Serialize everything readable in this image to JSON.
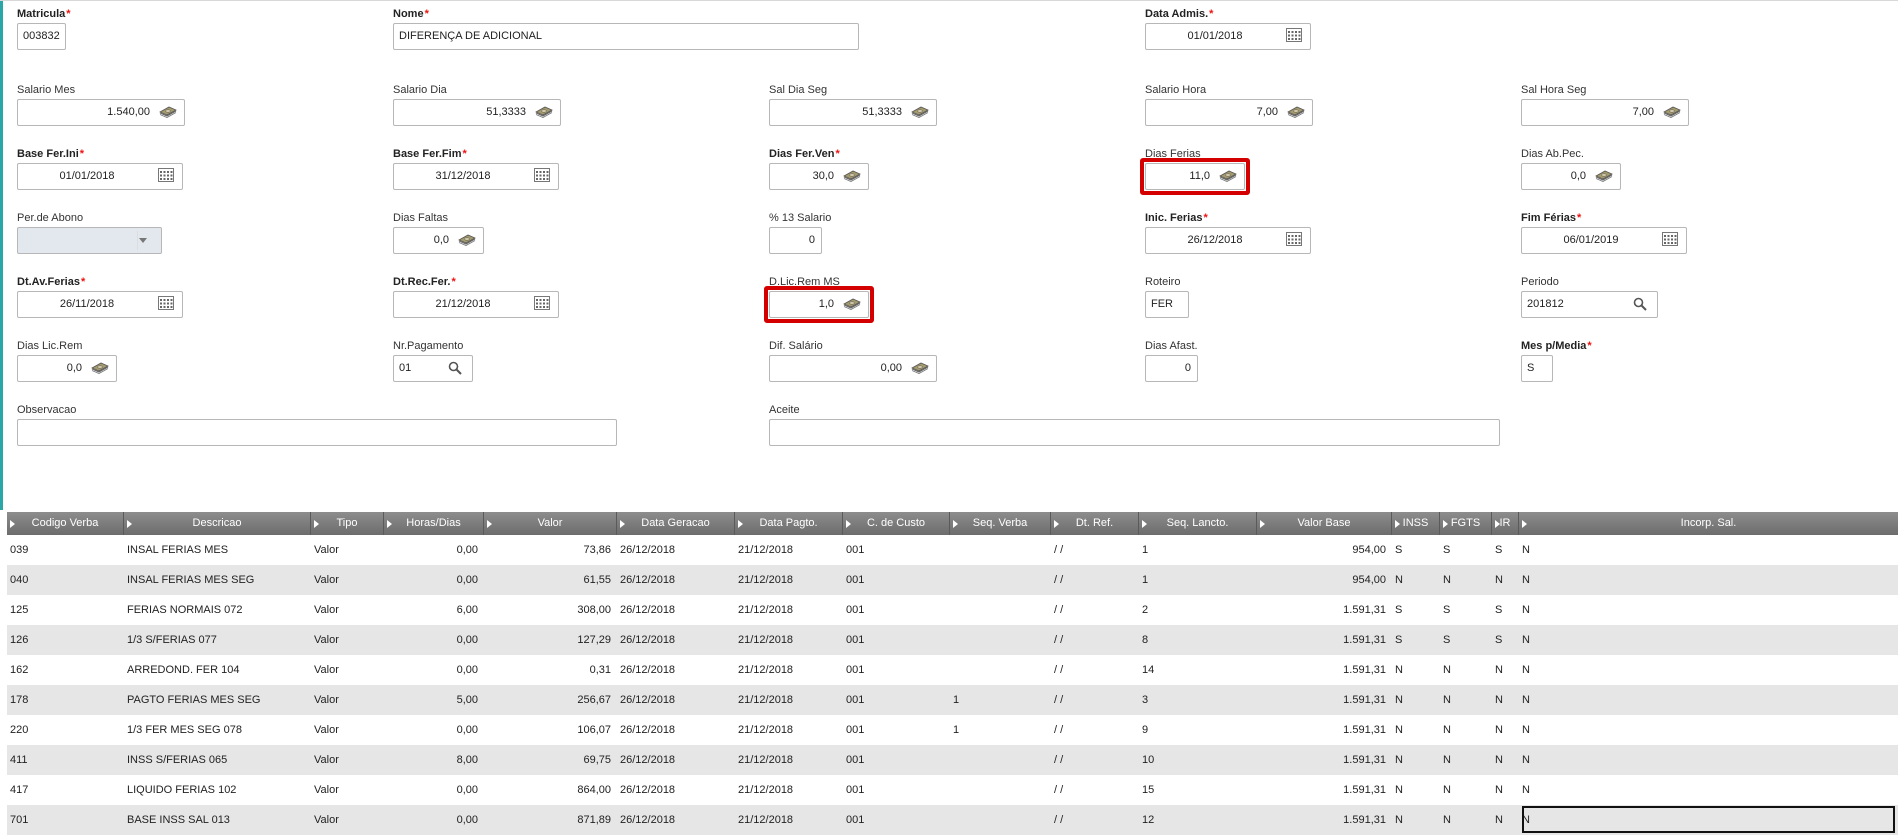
{
  "form": {
    "matricula": {
      "label": "Matricula",
      "value": "003832"
    },
    "nome": {
      "label": "Nome",
      "value": "DIFERENÇA DE ADICIONAL"
    },
    "data_admis": {
      "label": "Data Admis.",
      "value": "01/01/2018"
    },
    "salario_mes": {
      "label": "Salario Mes",
      "value": "1.540,00"
    },
    "salario_dia": {
      "label": "Salario Dia",
      "value": "51,3333"
    },
    "sal_dia_seg": {
      "label": "Sal Dia Seg",
      "value": "51,3333"
    },
    "salario_hora": {
      "label": "Salario Hora",
      "value": "7,00"
    },
    "sal_hora_seg": {
      "label": "Sal Hora Seg",
      "value": "7,00"
    },
    "base_fer_ini": {
      "label": "Base Fer.Ini",
      "value": "01/01/2018"
    },
    "base_fer_fim": {
      "label": "Base Fer.Fim",
      "value": "31/12/2018"
    },
    "dias_fer_ven": {
      "label": "Dias Fer.Ven",
      "value": "30,0"
    },
    "dias_ferias": {
      "label": "Dias Ferias",
      "value": "11,0"
    },
    "dias_ab_pec": {
      "label": "Dias Ab.Pec.",
      "value": "0,0"
    },
    "per_abono": {
      "label": "Per.de Abono",
      "value": ""
    },
    "dias_faltas": {
      "label": "Dias Faltas",
      "value": "0,0"
    },
    "pct_13_salario": {
      "label": "% 13 Salario",
      "value": "0"
    },
    "inic_ferias": {
      "label": "Inic. Ferias",
      "value": "26/12/2018"
    },
    "fim_ferias": {
      "label": "Fim Férias",
      "value": "06/01/2019"
    },
    "dt_av_ferias": {
      "label": "Dt.Av.Ferias",
      "value": "26/11/2018"
    },
    "dt_rec_fer": {
      "label": "Dt.Rec.Fer.",
      "value": "21/12/2018"
    },
    "d_lic_rem_ms": {
      "label": "D.Lic.Rem MS",
      "value": "1,0"
    },
    "roteiro": {
      "label": "Roteiro",
      "value": "FER"
    },
    "periodo": {
      "label": "Periodo",
      "value": "201812"
    },
    "dias_lic_rem": {
      "label": "Dias Lic.Rem",
      "value": "0,0"
    },
    "nr_pagamento": {
      "label": "Nr.Pagamento",
      "value": "01"
    },
    "dif_salario": {
      "label": "Dif. Salário",
      "value": "0,00"
    },
    "dias_afast": {
      "label": "Dias Afast.",
      "value": "0"
    },
    "mes_p_media": {
      "label": "Mes p/Media",
      "value": "S"
    },
    "observacao": {
      "label": "Observacao",
      "value": ""
    },
    "aceite": {
      "label": "Aceite",
      "value": ""
    }
  },
  "grid": {
    "columns": [
      "Codigo Verba",
      "Descricao",
      "Tipo",
      "Horas/Dias",
      "Valor",
      "Data Geracao",
      "Data Pagto.",
      "C. de Custo",
      "Seq. Verba",
      "Dt. Ref.",
      "Seq. Lancto.",
      "Valor Base",
      "INSS",
      "FGTS",
      "IR",
      "Incorp. Sal."
    ],
    "rows": [
      [
        "039",
        "INSAL FERIAS MES",
        "Valor",
        "0,00",
        "73,86",
        "26/12/2018",
        "21/12/2018",
        "001",
        "",
        " / /",
        "1",
        "954,00",
        "S",
        "S",
        "S",
        "N"
      ],
      [
        "040",
        "INSAL FERIAS MES SEG",
        "Valor",
        "0,00",
        "61,55",
        "26/12/2018",
        "21/12/2018",
        "001",
        "",
        " / /",
        "1",
        "954,00",
        "N",
        "N",
        "N",
        "N"
      ],
      [
        "125",
        "FERIAS NORMAIS 072",
        "Valor",
        "6,00",
        "308,00",
        "26/12/2018",
        "21/12/2018",
        "001",
        "",
        " / /",
        "2",
        "1.591,31",
        "S",
        "S",
        "S",
        "N"
      ],
      [
        "126",
        "1/3 S/FERIAS 077",
        "Valor",
        "0,00",
        "127,29",
        "26/12/2018",
        "21/12/2018",
        "001",
        "",
        " / /",
        "8",
        "1.591,31",
        "S",
        "S",
        "S",
        "N"
      ],
      [
        "162",
        "ARREDOND. FER 104",
        "Valor",
        "0,00",
        "0,31",
        "26/12/2018",
        "21/12/2018",
        "001",
        "",
        " / /",
        "14",
        "1.591,31",
        "N",
        "N",
        "N",
        "N"
      ],
      [
        "178",
        "PAGTO FERIAS MES SEG",
        "Valor",
        "5,00",
        "256,67",
        "26/12/2018",
        "21/12/2018",
        "001",
        "1",
        " / /",
        "3",
        "1.591,31",
        "N",
        "N",
        "N",
        "N"
      ],
      [
        "220",
        "1/3 FER MES SEG 078",
        "Valor",
        "0,00",
        "106,07",
        "26/12/2018",
        "21/12/2018",
        "001",
        "1",
        " / /",
        "9",
        "1.591,31",
        "N",
        "N",
        "N",
        "N"
      ],
      [
        "411",
        "INSS  S/FERIAS 065",
        "Valor",
        "8,00",
        "69,75",
        "26/12/2018",
        "21/12/2018",
        "001",
        "",
        " / /",
        "10",
        "1.591,31",
        "N",
        "N",
        "N",
        "N"
      ],
      [
        "417",
        "LIQUIDO FERIAS 102",
        "Valor",
        "0,00",
        "864,00",
        "26/12/2018",
        "21/12/2018",
        "001",
        "",
        " / /",
        "15",
        "1.591,31",
        "N",
        "N",
        "N",
        "N"
      ],
      [
        "701",
        "BASE INSS SAL 013",
        "Valor",
        "0,00",
        "871,89",
        "26/12/2018",
        "21/12/2018",
        "001",
        "",
        " / /",
        "12",
        "1.591,31",
        "N",
        "N",
        "N",
        "N"
      ]
    ]
  },
  "colors": {
    "accent_bar": "#2aa6a6",
    "highlight": "#d40000",
    "required_star": "#e11111",
    "header_bg": "#7a7a7a"
  }
}
